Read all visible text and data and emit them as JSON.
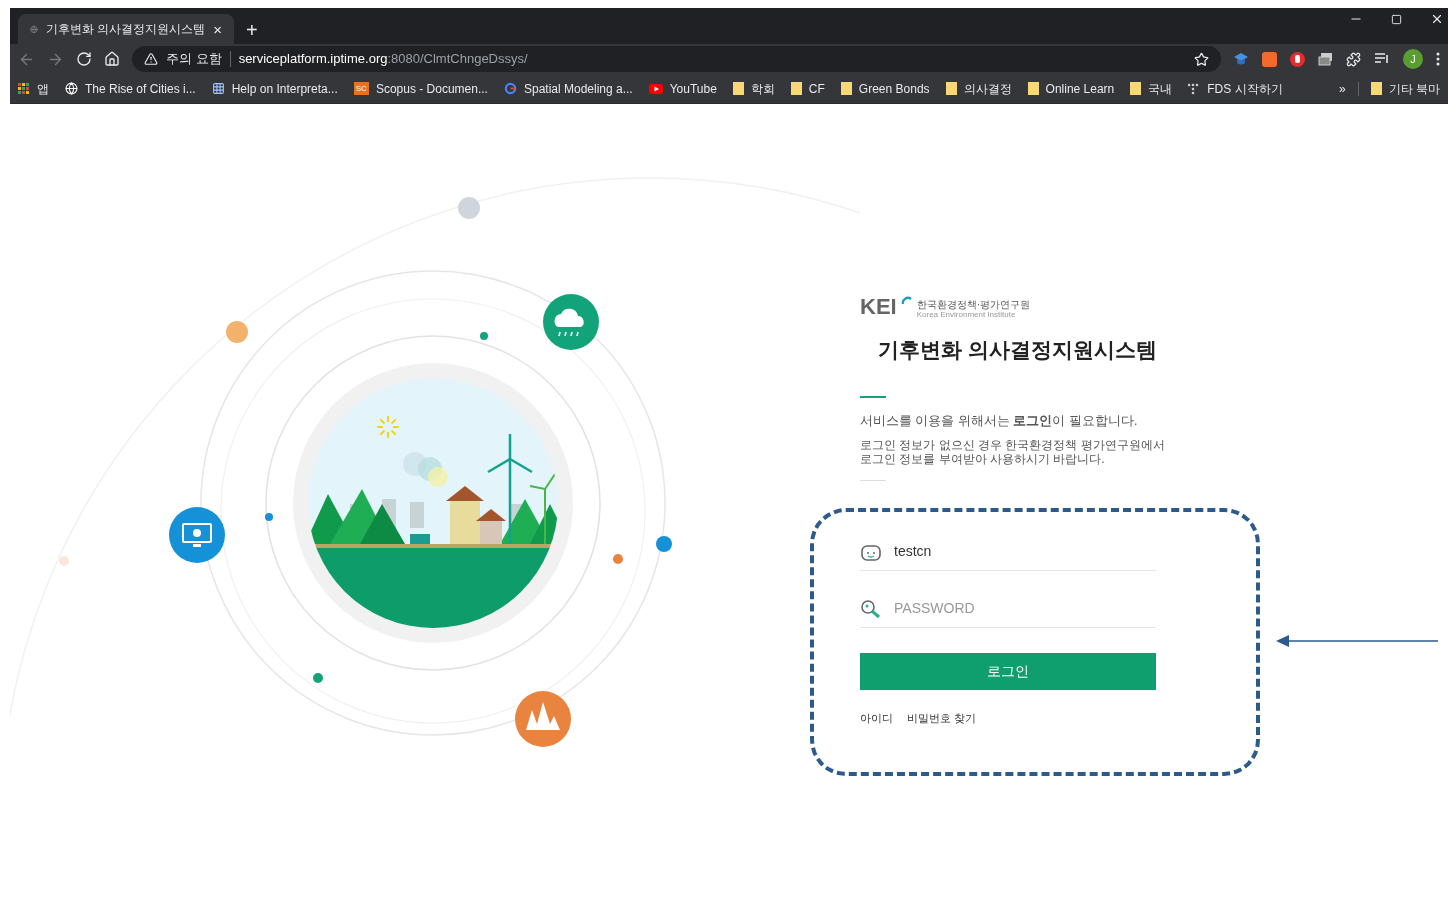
{
  "browser": {
    "tab": {
      "title": "기후변화 의사결정지원시스템",
      "close": "×",
      "new_tab": "+"
    },
    "address": {
      "warning": "주의 요함",
      "host": "serviceplatform.iptime.org",
      "path": ":8080/ClmtChngeDssys/"
    },
    "profile_initial": "J",
    "bookmarks": [
      {
        "kind": "apps",
        "label": "앱"
      },
      {
        "kind": "globe",
        "label": "The Rise of Cities i..."
      },
      {
        "kind": "grid",
        "label": "Help on Interpreta..."
      },
      {
        "kind": "sc",
        "label": "Scopus - Documen...",
        "badge": "SC"
      },
      {
        "kind": "google",
        "label": "Spatial Modeling a..."
      },
      {
        "kind": "youtube",
        "label": "YouTube"
      },
      {
        "kind": "folder",
        "label": "학회"
      },
      {
        "kind": "folder",
        "label": "CF"
      },
      {
        "kind": "folder",
        "label": "Green Bonds"
      },
      {
        "kind": "folder",
        "label": "의사결정"
      },
      {
        "kind": "folder",
        "label": "Online Learn"
      },
      {
        "kind": "folder",
        "label": "국내"
      },
      {
        "kind": "dots",
        "label": "FDS 시작하기"
      }
    ],
    "overflow": "»",
    "other_bookmarks": "기타 북마"
  },
  "login": {
    "logo": {
      "mark": "KEI",
      "name_ko": "한국환경정책·평가연구원",
      "name_en": "Korea Environment Institute"
    },
    "title": "기후변화 의사결정지원시스템",
    "notice": "서비스를 이용을 위해서는 **로그인**이 필요합니다.",
    "info": "로그인 정보가 없으신 경우 한국환경정책 평가연구원에서 로그인 정보를 부여받아 사용하시기 바랍니다.",
    "id_field": {
      "value": "testcn"
    },
    "password_field": {
      "placeholder": "PASSWORD"
    },
    "submit": "로그인",
    "links": [
      "아이디",
      "비밀번호 찾기"
    ]
  }
}
